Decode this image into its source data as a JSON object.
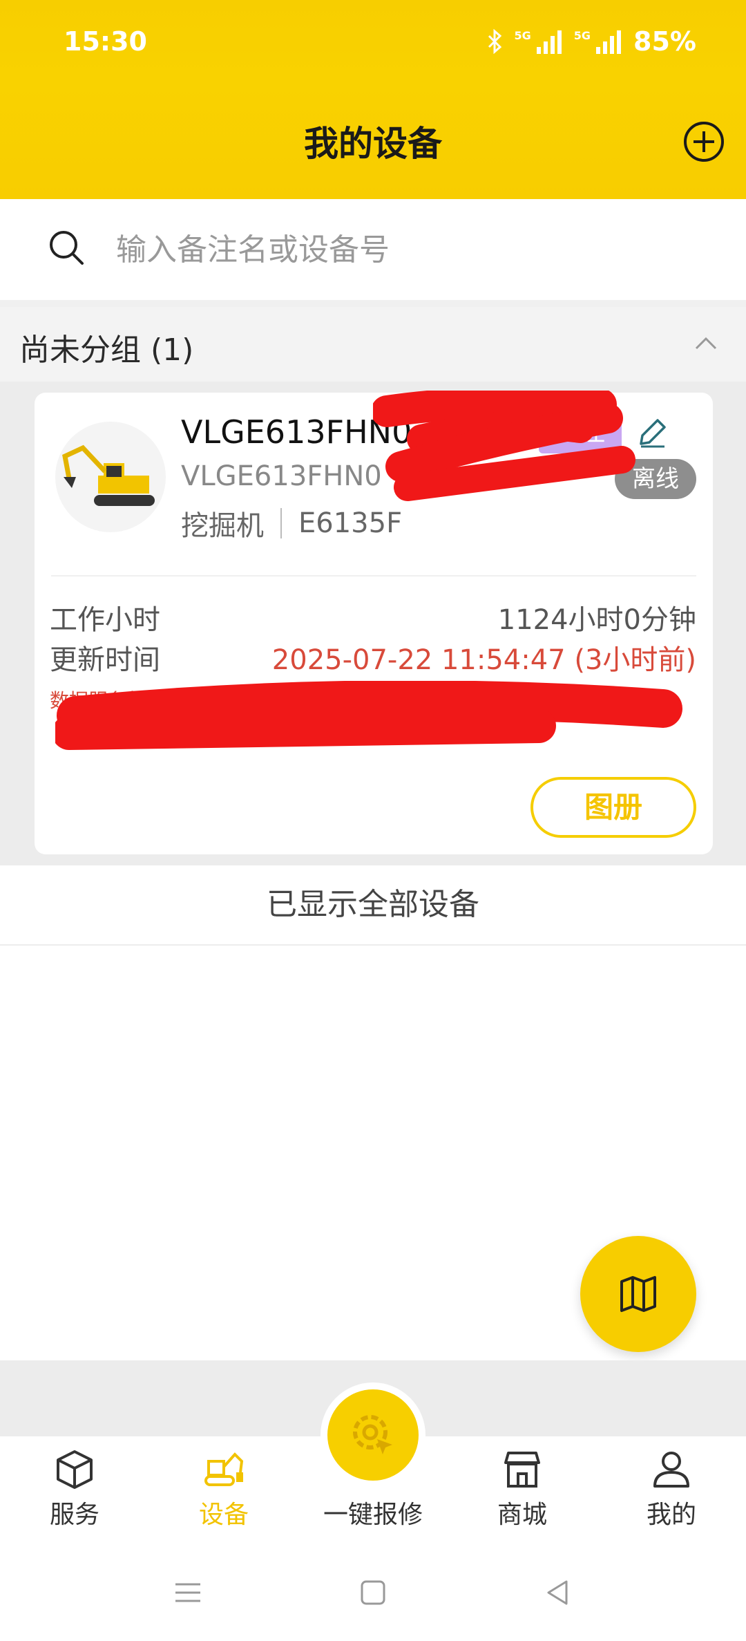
{
  "status_bar": {
    "time": "15:30",
    "battery": "85%",
    "network1": "5G",
    "network2": "5G"
  },
  "header": {
    "title": "我的设备"
  },
  "search": {
    "placeholder": "输入备注名或设备号"
  },
  "group": {
    "title": "尚未分组 (1)"
  },
  "device": {
    "name": "VLGE613FHN0",
    "id": "VLGE613FHN0",
    "type": "挖掘机",
    "model": "E6135F",
    "remark_badge": "备注",
    "status": "离线",
    "work_hours_label": "工作小时",
    "work_hours_value": "1124小时0分钟",
    "update_time_label": "更新时间",
    "update_time_value": "2025-07-22 11:54:47 (3小时前)",
    "notice": "数据服务将于2025-07-",
    "album_button": "图册"
  },
  "list_footer": "已显示全部设备",
  "bottom_nav": {
    "service": "服务",
    "devices": "设备",
    "repair": "一键报修",
    "mall": "商城",
    "mine": "我的"
  },
  "colors": {
    "accent": "#f7cd00",
    "danger": "#d84a3a",
    "badge_purple": "#c9a7f2",
    "offline": "#8e8e8e"
  }
}
